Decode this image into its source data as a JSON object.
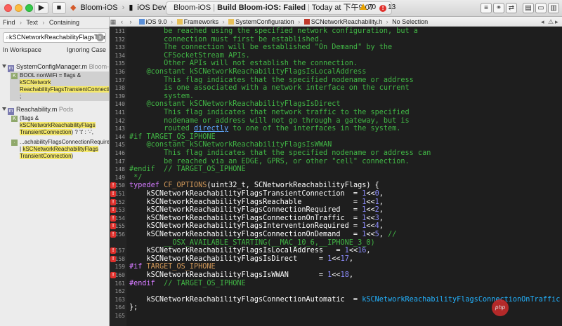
{
  "toolbar": {
    "play_icon": "play-icon",
    "stop_icon": "stop-icon",
    "scheme": "Bloom-iOS",
    "destination": "iOS Device",
    "activity_project": "Bloom-iOS",
    "activity_status": "Build Bloom-iOS: Failed",
    "activity_time": "Today at 下午9:07",
    "warning_count": "70",
    "error_count": "13"
  },
  "navigator": {
    "find_mode": [
      "Find",
      "Text",
      "Containing"
    ],
    "search_value": "kSCNetworkReachabilityFlagsTransier",
    "scope": "In Workspace",
    "match_option": "Ignoring Case",
    "groups": [
      {
        "file": "SystemConfigManager.m",
        "project": "Bloom-iOS",
        "matches": [
          {
            "prefix": "BOOL nonWiFi = flags & ",
            "hit": "kSCNetwork ReachabilityFlagsTransientConnection",
            "suffix": " ;",
            "selected": true
          }
        ]
      },
      {
        "file": "Reachability.m",
        "project": "Pods",
        "matches": [
          {
            "prefix": "(flags & ",
            "hit": "kSCNetworkReachabilityFlags TransientConnection",
            "suffix": ")  ? 't' : '-',",
            "selected": false
          },
          {
            "prefix": "...achabilityFlagsConnectionRequired | ",
            "hit": "kSCNetworkReachabilityFlags TransientConnection",
            "suffix": ")",
            "selected": false
          }
        ]
      }
    ]
  },
  "jumpbar": {
    "items": [
      "iOS 9.0",
      "Frameworks",
      "SystemConfiguration",
      "SCNetworkReachability.h",
      "No Selection"
    ]
  },
  "code_lines": [
    {
      "n": "131",
      "err": false,
      "segs": [
        [
          "c-comment",
          "        be reached using the specified network configuration, but a"
        ]
      ]
    },
    {
      "n": "132",
      "err": false,
      "segs": [
        [
          "c-comment",
          "        connection must first be established."
        ]
      ]
    },
    {
      "n": "133",
      "err": false,
      "segs": [
        [
          "c-comment",
          "        The connection will be established \"On Demand\" by the"
        ]
      ]
    },
    {
      "n": "134",
      "err": false,
      "segs": [
        [
          "c-comment",
          "        CFSocketStream APIs."
        ]
      ]
    },
    {
      "n": "135",
      "err": false,
      "segs": [
        [
          "c-comment",
          "        Other APIs will not establish the connection."
        ]
      ]
    },
    {
      "n": "136",
      "err": false,
      "segs": [
        [
          "c-comment",
          "    @constant kSCNetworkReachabilityFlagsIsLocalAddress"
        ]
      ]
    },
    {
      "n": "137",
      "err": false,
      "segs": [
        [
          "c-comment",
          "        This flag indicates that the specified nodename or address"
        ]
      ]
    },
    {
      "n": "138",
      "err": false,
      "segs": [
        [
          "c-comment",
          "        is one associated with a network interface on the current"
        ]
      ]
    },
    {
      "n": "139",
      "err": false,
      "segs": [
        [
          "c-comment",
          "        system."
        ]
      ]
    },
    {
      "n": "140",
      "err": false,
      "segs": [
        [
          "c-comment",
          "    @constant kSCNetworkReachabilityFlagsIsDirect"
        ]
      ]
    },
    {
      "n": "141",
      "err": false,
      "segs": [
        [
          "c-comment",
          "        This flag indicates that network traffic to the specified"
        ]
      ]
    },
    {
      "n": "142",
      "err": false,
      "segs": [
        [
          "c-comment",
          "        nodename or address will not go through a gateway, but is"
        ]
      ]
    },
    {
      "n": "143",
      "err": false,
      "segs": [
        [
          "c-comment",
          "        routed "
        ],
        [
          "c-link",
          "directly"
        ],
        [
          "c-comment",
          " to one of the interfaces in the system."
        ]
      ]
    },
    {
      "n": "144",
      "err": false,
      "segs": [
        [
          "c-comment",
          "#if TARGET_OS_IPHONE"
        ]
      ]
    },
    {
      "n": "145",
      "err": false,
      "segs": [
        [
          "c-comment",
          "    @constant kSCNetworkReachabilityFlagsIsWWAN"
        ]
      ]
    },
    {
      "n": "146",
      "err": false,
      "segs": [
        [
          "c-comment",
          "        This flag indicates that the specified nodename or address can"
        ]
      ]
    },
    {
      "n": "147",
      "err": false,
      "segs": [
        [
          "c-comment",
          "        be reached via an EDGE, GPRS, or other \"cell\" connection."
        ]
      ]
    },
    {
      "n": "148",
      "err": false,
      "segs": [
        [
          "c-comment",
          "#endif  // TARGET_OS_IPHONE"
        ]
      ]
    },
    {
      "n": "149",
      "err": false,
      "segs": [
        [
          "c-comment",
          " */"
        ]
      ]
    },
    {
      "n": "150",
      "err": true,
      "segs": [
        [
          "c-kw",
          "typedef"
        ],
        [
          "c-plain",
          " "
        ],
        [
          "c-macro",
          "CF_OPTIONS"
        ],
        [
          "c-plain",
          "(uint32_t, SCNetworkReachabilityFlags) {"
        ]
      ]
    },
    {
      "n": "151",
      "err": true,
      "segs": [
        [
          "c-plain",
          "    kSCNetworkReachabilityFlagsTransientConnection  = "
        ],
        [
          "c-num",
          "1"
        ],
        [
          "c-plain",
          "<<"
        ],
        [
          "c-num",
          "0"
        ],
        [
          "c-plain",
          ","
        ]
      ]
    },
    {
      "n": "152",
      "err": true,
      "segs": [
        [
          "c-plain",
          "    kSCNetworkReachabilityFlagsReachable            = "
        ],
        [
          "c-num",
          "1"
        ],
        [
          "c-plain",
          "<<"
        ],
        [
          "c-num",
          "1"
        ],
        [
          "c-plain",
          ","
        ]
      ]
    },
    {
      "n": "153",
      "err": true,
      "segs": [
        [
          "c-plain",
          "    kSCNetworkReachabilityFlagsConnectionRequired   = "
        ],
        [
          "c-num",
          "1"
        ],
        [
          "c-plain",
          "<<"
        ],
        [
          "c-num",
          "2"
        ],
        [
          "c-plain",
          ","
        ]
      ]
    },
    {
      "n": "154",
      "err": true,
      "segs": [
        [
          "c-plain",
          "    kSCNetworkReachabilityFlagsConnectionOnTraffic  = "
        ],
        [
          "c-num",
          "1"
        ],
        [
          "c-plain",
          "<<"
        ],
        [
          "c-num",
          "3"
        ],
        [
          "c-plain",
          ","
        ]
      ]
    },
    {
      "n": "155",
      "err": true,
      "segs": [
        [
          "c-plain",
          "    kSCNetworkReachabilityFlagsInterventionRequired = "
        ],
        [
          "c-num",
          "1"
        ],
        [
          "c-plain",
          "<<"
        ],
        [
          "c-num",
          "4"
        ],
        [
          "c-plain",
          ","
        ]
      ]
    },
    {
      "n": "156",
      "err": true,
      "segs": [
        [
          "c-plain",
          "    kSCNetworkReachabilityFlagsConnectionOnDemand   = "
        ],
        [
          "c-num",
          "1"
        ],
        [
          "c-plain",
          "<<"
        ],
        [
          "c-num",
          "5"
        ],
        [
          "c-plain",
          ", "
        ],
        [
          "c-comment",
          "//"
        ]
      ]
    },
    {
      "n": "",
      "err": false,
      "segs": [
        [
          "c-comment",
          "        __OSX_AVAILABLE_STARTING(__MAC_10_6,__IPHONE_3_0)"
        ]
      ]
    },
    {
      "n": "157",
      "err": true,
      "segs": [
        [
          "c-plain",
          "    kSCNetworkReachabilityFlagsIsLocalAddress   = "
        ],
        [
          "c-num",
          "1"
        ],
        [
          "c-plain",
          "<<"
        ],
        [
          "c-num",
          "16"
        ],
        [
          "c-plain",
          ","
        ]
      ]
    },
    {
      "n": "158",
      "err": true,
      "segs": [
        [
          "c-plain",
          "    kSCNetworkReachabilityFlagsIsDirect     = "
        ],
        [
          "c-num",
          "1"
        ],
        [
          "c-plain",
          "<<"
        ],
        [
          "c-num",
          "17"
        ],
        [
          "c-plain",
          ","
        ]
      ]
    },
    {
      "n": "159",
      "err": false,
      "segs": [
        [
          "c-kw",
          "#if"
        ],
        [
          "c-plain",
          " "
        ],
        [
          "c-macro",
          "TARGET_OS_IPHONE"
        ]
      ]
    },
    {
      "n": "160",
      "err": true,
      "segs": [
        [
          "c-plain",
          "    kSCNetworkReachabilityFlagsIsWWAN       = "
        ],
        [
          "c-num",
          "1"
        ],
        [
          "c-plain",
          "<<"
        ],
        [
          "c-num",
          "18"
        ],
        [
          "c-plain",
          ","
        ]
      ]
    },
    {
      "n": "161",
      "err": false,
      "segs": [
        [
          "c-kw",
          "#endif"
        ],
        [
          "c-plain",
          "  "
        ],
        [
          "c-comment",
          "// TARGET_OS_IPHONE"
        ]
      ]
    },
    {
      "n": "162",
      "err": false,
      "segs": [
        [
          "c-plain",
          ""
        ]
      ]
    },
    {
      "n": "163",
      "err": false,
      "segs": [
        [
          "c-plain",
          "    kSCNetworkReachabilityFlagsConnectionAutomatic  = "
        ],
        [
          "c-proj",
          "kSCNetworkReachabilityFlagsConnectionOnTraffic"
        ]
      ]
    },
    {
      "n": "164",
      "err": false,
      "segs": [
        [
          "c-plain",
          "};"
        ]
      ]
    },
    {
      "n": "165",
      "err": false,
      "segs": [
        [
          "c-plain",
          ""
        ]
      ]
    }
  ],
  "colors": {
    "error": "#e0302c",
    "warning": "#e8a200",
    "comment": "#41b645",
    "keyword": "#d47aff",
    "number": "#8e8eff",
    "editor_bg": "#1e1e1e",
    "search_highlight": "#f4e86a"
  },
  "watermark": "php"
}
